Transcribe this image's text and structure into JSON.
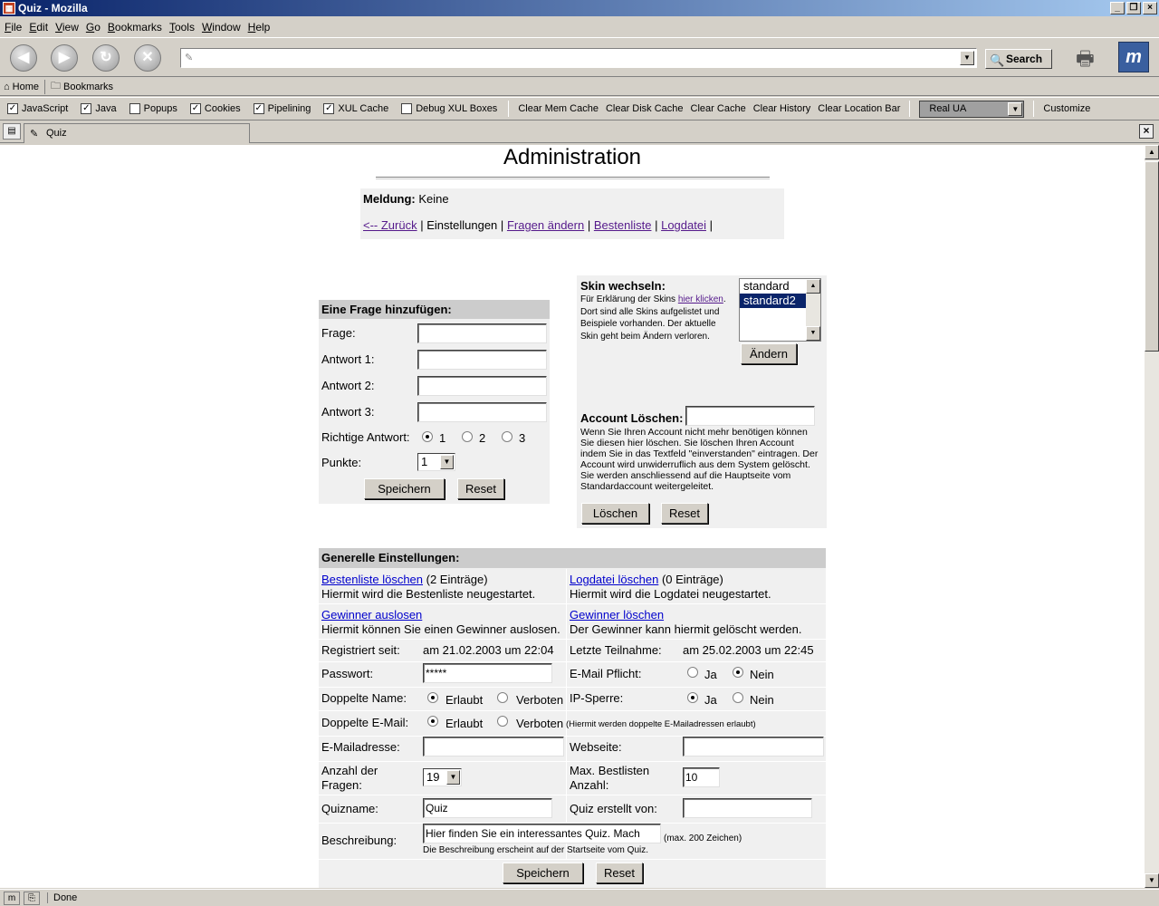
{
  "window": {
    "title": "Quiz - Mozilla"
  },
  "menu": [
    "File",
    "Edit",
    "View",
    "Go",
    "Bookmarks",
    "Tools",
    "Window",
    "Help"
  ],
  "toolbar": {
    "search_label": "Search",
    "url_value": ""
  },
  "personal": {
    "home": "Home",
    "bookmarks": "Bookmarks"
  },
  "prefbar": {
    "checks": [
      {
        "label": "JavaScript",
        "checked": true
      },
      {
        "label": "Java",
        "checked": true
      },
      {
        "label": "Popups",
        "checked": false
      },
      {
        "label": "Cookies",
        "checked": true
      },
      {
        "label": "Pipelining",
        "checked": true
      },
      {
        "label": "XUL Cache",
        "checked": true
      },
      {
        "label": "Debug XUL Boxes",
        "checked": false
      }
    ],
    "buttons": [
      "Clear Mem Cache",
      "Clear Disk Cache",
      "Clear Cache",
      "Clear History",
      "Clear Location Bar"
    ],
    "ua_select": "Real UA",
    "customize": "Customize"
  },
  "tab": {
    "label": "Quiz"
  },
  "status": {
    "text": "Done"
  },
  "page": {
    "title": "Administration",
    "meldung_label": "Meldung:",
    "meldung_value": "Keine",
    "nav": {
      "back": "<-- Zurück",
      "current": "Einstellungen",
      "fragen": "Fragen ändern",
      "bestenliste": "Bestenliste",
      "logdatei": "Logdatei",
      "sep": "|"
    },
    "add_question": {
      "header": "Eine Frage hinzufügen:",
      "frage": "Frage:",
      "antwort1": "Antwort 1:",
      "antwort2": "Antwort 2:",
      "antwort3": "Antwort 3:",
      "richtige": "Richtige Antwort:",
      "radio1": "1",
      "radio2": "2",
      "radio3": "3",
      "punkte": "Punkte:",
      "punkte_value": "1",
      "save": "Speichern",
      "reset": "Reset"
    },
    "skin": {
      "header": "Skin wechseln:",
      "desc_pre": "Für Erklärung der Skins",
      "desc_link": "hier klicken",
      "desc_post": ". Dort sind alle Skins aufgelistet und Beispiele vorhanden. Der aktuelle Skin geht beim Ändern verloren.",
      "options": [
        "standard",
        "standard2"
      ],
      "selected": "standard2",
      "change": "Ändern"
    },
    "account": {
      "header": "Account Löschen:",
      "desc": "Wenn Sie Ihren Account nicht mehr benötigen können Sie diesen hier löschen. Sie löschen Ihren Account indem Sie in das Textfeld \"einverstanden\" eintragen. Der Account wird unwiderruflich aus dem System gelöscht. Sie werden anschliessend auf die Hauptseite vom Standardaccount weitergeleitet.",
      "delete": "Löschen",
      "reset": "Reset"
    },
    "general": {
      "header": "Generelle Einstellungen:",
      "bestenliste_link": "Bestenliste löschen",
      "bestenliste_count": "(2 Einträge)",
      "bestenliste_desc": "Hiermit wird die Bestenliste neugestartet.",
      "logdatei_link": "Logdatei löschen",
      "logdatei_count": "(0 Einträge)",
      "logdatei_desc": "Hiermit wird die Logdatei neugestartet.",
      "gewinner_link": "Gewinner auslosen",
      "gewinner_desc": "Hiermit können Sie einen Gewinner auslosen.",
      "gewinner_del_link": "Gewinner löschen",
      "gewinner_del_desc": "Der Gewinner kann hiermit gelöscht werden.",
      "registriert_label": "Registriert seit:",
      "registriert_value": "am 21.02.2003 um 22:04",
      "letzte_label": "Letzte Teilnahme:",
      "letzte_value": "am 25.02.2003 um 22:45",
      "passwort_label": "Passwort:",
      "passwort_value": "*****",
      "email_pflicht_label": "E-Mail Pflicht:",
      "ja": "Ja",
      "nein": "Nein",
      "doppelte_name_label": "Doppelte Name:",
      "erlaubt": "Erlaubt",
      "verboten": "Verboten",
      "ip_sperre_label": "IP-Sperre:",
      "doppelte_email_label": "Doppelte E-Mail:",
      "doppelte_email_note": "(Hiermit werden doppelte E-Mailadressen erlaubt)",
      "emailadresse_label": "E-Mailadresse:",
      "webseite_label": "Webseite:",
      "anzahl_label_1": "Anzahl der",
      "anzahl_label_2": "Fragen:",
      "anzahl_value": "19",
      "max_label_1": "Max. Bestlisten",
      "max_label_2": "Anzahl:",
      "max_value": "10",
      "quizname_label": "Quizname:",
      "quizname_value": "Quiz",
      "erstellt_label": "Quiz erstellt von:",
      "beschreibung_label": "Beschreibung:",
      "beschreibung_value": "Hier finden Sie ein interessantes Quiz. Mach",
      "beschreibung_max": "(max. 200 Zeichen)",
      "beschreibung_note": "Die Beschreibung erscheint auf der Startseite vom Quiz.",
      "save": "Speichern",
      "reset": "Reset"
    }
  }
}
